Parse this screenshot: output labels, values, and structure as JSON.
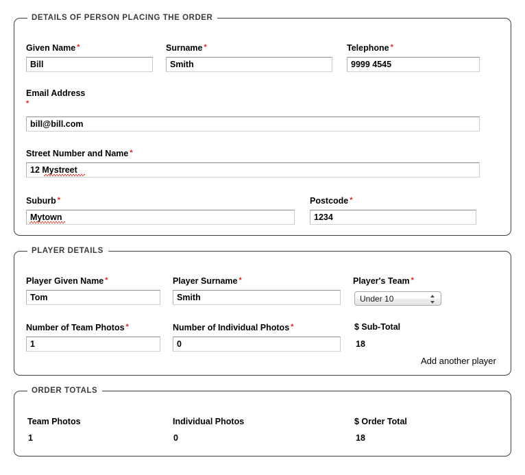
{
  "colors": {
    "panel_border": "#3f3f3f",
    "legend_text": "#3a3a3a",
    "required_asterisk": "#e02020",
    "spellcheck_underline": "#e53b2e",
    "input_border_top": "#8e8e8e",
    "page_background": "#ffffff",
    "text": "#000000"
  },
  "required_marker": "*",
  "panels": [
    {
      "legend": "DETAILS OF PERSON PLACING THE ORDER",
      "fields": [
        {
          "label": "Given Name",
          "required": true,
          "value": "Bill"
        },
        {
          "label": "Surname",
          "required": true,
          "value": "Smith"
        },
        {
          "label": "Telephone",
          "required": true,
          "value": "9999 4545"
        },
        {
          "label": "Email Address",
          "required": true,
          "value": "bill@bill.com"
        },
        {
          "label": "Street Number and Name",
          "required": true,
          "value": "12 Mystreet"
        },
        {
          "label": "Suburb",
          "required": true,
          "value": "Mytown"
        },
        {
          "label": "Postcode",
          "required": true,
          "value": "1234"
        }
      ]
    },
    {
      "legend": "PLAYER DETAILS",
      "fields": [
        {
          "label": "Player Given Name",
          "required": true,
          "value": "Tom"
        },
        {
          "label": "Player Surname",
          "required": true,
          "value": "Smith"
        },
        {
          "label": "Player's Team",
          "required": true,
          "value": "Under 10"
        },
        {
          "label": "Number of Team Photos",
          "required": true,
          "value": "1"
        },
        {
          "label": "Number of Individual Photos",
          "required": true,
          "value": "0"
        },
        {
          "label": "$ Sub-Total",
          "required": false,
          "value": "18"
        }
      ],
      "add_player_link": "Add another player"
    },
    {
      "legend": "ORDER TOTALS",
      "fields": [
        {
          "label": "Team Photos",
          "required": false,
          "value": "1"
        },
        {
          "label": "Individual Photos",
          "required": false,
          "value": "0"
        },
        {
          "label": "$ Order Total",
          "required": false,
          "value": "18"
        }
      ]
    }
  ]
}
